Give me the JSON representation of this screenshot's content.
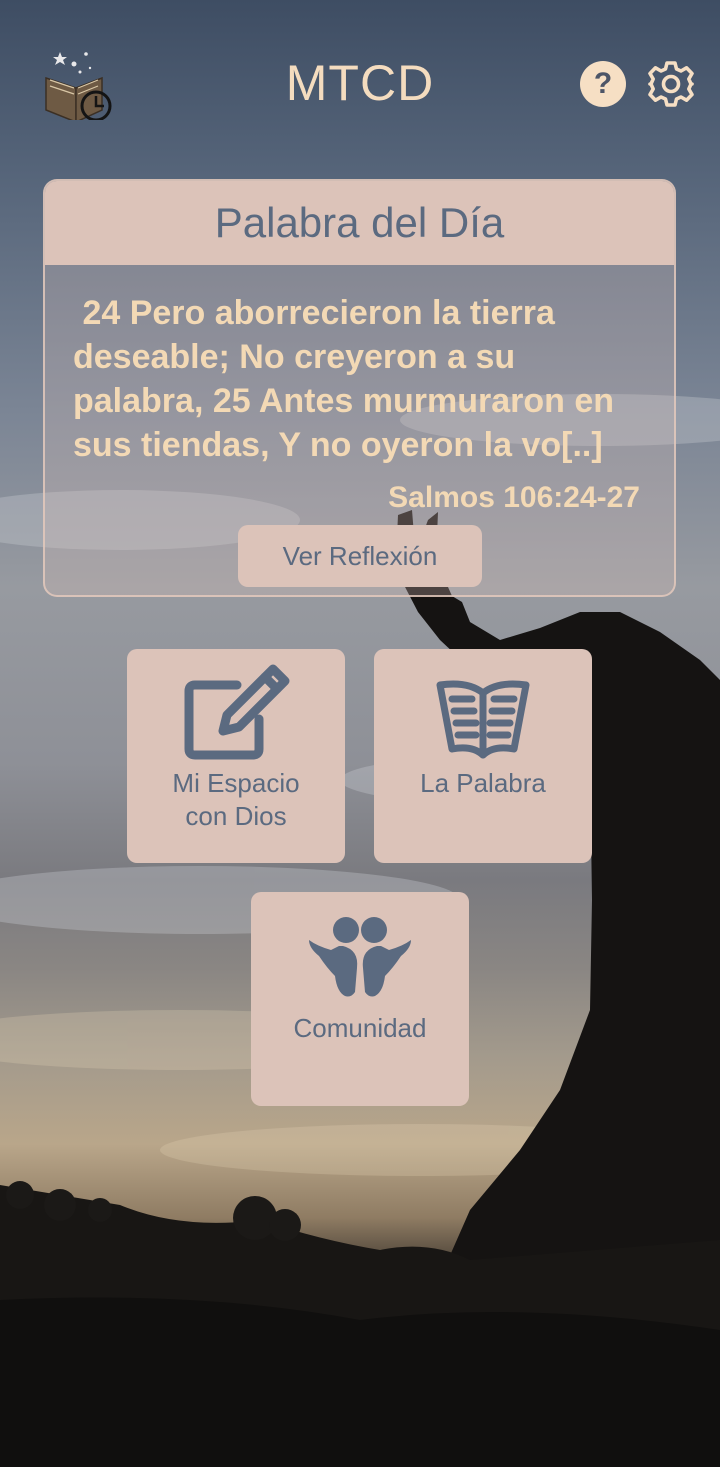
{
  "header": {
    "title": "MTCD",
    "logo_icon": "book-clock-logo-icon",
    "help_icon": "help-icon",
    "help_glyph": "?",
    "settings_icon": "gear-icon"
  },
  "daily_word": {
    "title": "Palabra del Día",
    "verse": " 24 Pero aborrecieron la tierra deseable; No creyeron a su palabra, 25 Antes murmuraron en sus tiendas, Y no oyeron la vo[..]",
    "reference": "Salmos 106:24-27",
    "button_label": "Ver Reflexión"
  },
  "tiles": [
    {
      "label": "Mi Espacio\ncon Dios",
      "icon": "edit-icon"
    },
    {
      "label": "La Palabra",
      "icon": "open-book-icon"
    },
    {
      "label": "Comunidad",
      "icon": "community-icon"
    }
  ],
  "colors": {
    "accent_text": "#f3d9b5",
    "tile_background": "#dcc3b9",
    "tile_text": "#5b6a80"
  }
}
